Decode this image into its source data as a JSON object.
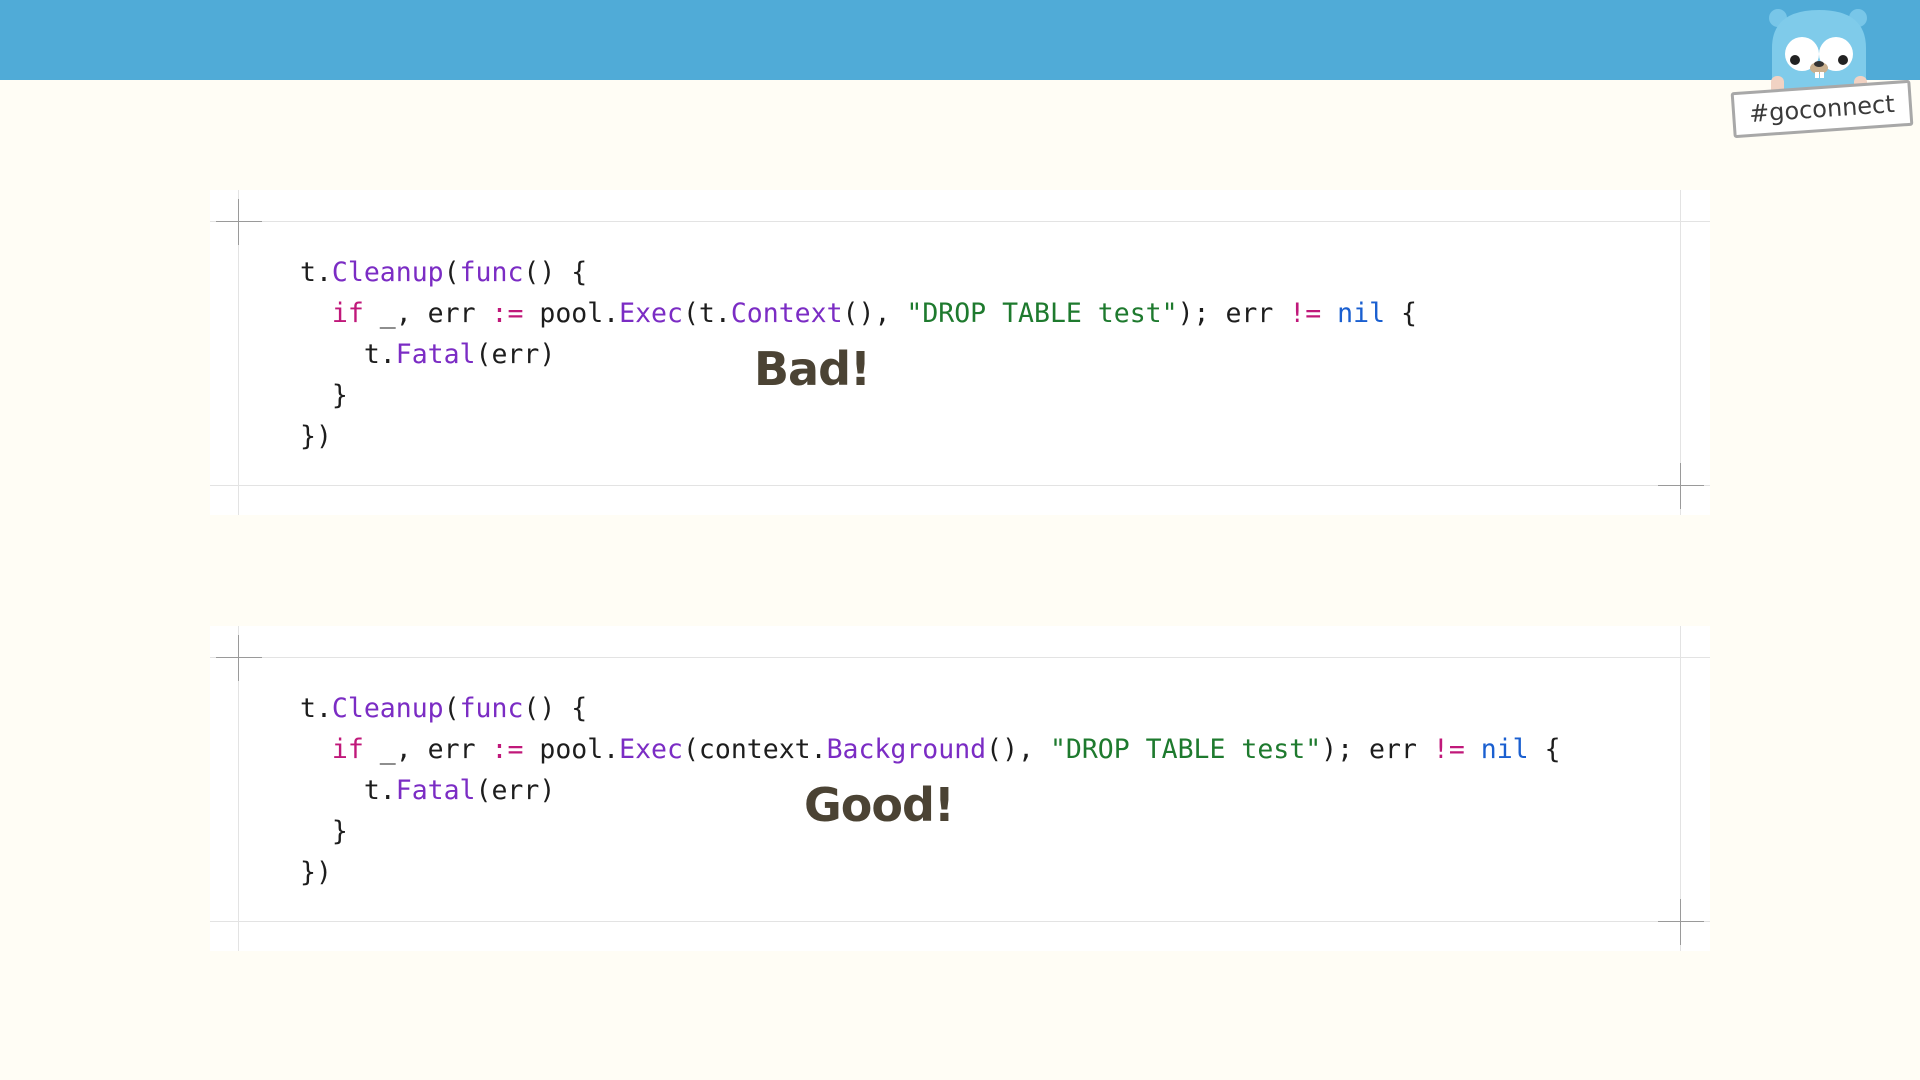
{
  "header": {
    "hashtag": "#goconnect"
  },
  "colors": {
    "header_bar": "#50abd7",
    "background": "#fffdf5",
    "function": "#7b2cc4",
    "keyword": "#c0187a",
    "string": "#1e7a2e",
    "nil": "#1a5fd0",
    "verdict": "#4b4334"
  },
  "examples": [
    {
      "verdict": "Bad!",
      "lines": [
        [
          {
            "t": "t.",
            "c": ""
          },
          {
            "t": "Cleanup",
            "c": "fn"
          },
          {
            "t": "(",
            "c": ""
          },
          {
            "t": "func",
            "c": "fn"
          },
          {
            "t": "() {",
            "c": ""
          }
        ],
        [
          {
            "t": "  ",
            "c": ""
          },
          {
            "t": "if",
            "c": "kw"
          },
          {
            "t": " _, err ",
            "c": ""
          },
          {
            "t": ":=",
            "c": "op"
          },
          {
            "t": " pool.",
            "c": ""
          },
          {
            "t": "Exec",
            "c": "fn"
          },
          {
            "t": "(t.",
            "c": ""
          },
          {
            "t": "Context",
            "c": "fn"
          },
          {
            "t": "(), ",
            "c": ""
          },
          {
            "t": "\"DROP TABLE test\"",
            "c": "str"
          },
          {
            "t": "); err ",
            "c": ""
          },
          {
            "t": "!=",
            "c": "op"
          },
          {
            "t": " ",
            "c": ""
          },
          {
            "t": "nil",
            "c": "nil"
          },
          {
            "t": " {",
            "c": ""
          }
        ],
        [
          {
            "t": "    t.",
            "c": ""
          },
          {
            "t": "Fatal",
            "c": "fn"
          },
          {
            "t": "(err)",
            "c": ""
          }
        ],
        [
          {
            "t": "  }",
            "c": ""
          }
        ],
        [
          {
            "t": "})",
            "c": ""
          }
        ]
      ]
    },
    {
      "verdict": "Good!",
      "lines": [
        [
          {
            "t": "t.",
            "c": ""
          },
          {
            "t": "Cleanup",
            "c": "fn"
          },
          {
            "t": "(",
            "c": ""
          },
          {
            "t": "func",
            "c": "fn"
          },
          {
            "t": "() {",
            "c": ""
          }
        ],
        [
          {
            "t": "  ",
            "c": ""
          },
          {
            "t": "if",
            "c": "kw"
          },
          {
            "t": " _, err ",
            "c": ""
          },
          {
            "t": ":=",
            "c": "op"
          },
          {
            "t": " pool.",
            "c": ""
          },
          {
            "t": "Exec",
            "c": "fn"
          },
          {
            "t": "(context.",
            "c": ""
          },
          {
            "t": "Background",
            "c": "fn"
          },
          {
            "t": "(), ",
            "c": ""
          },
          {
            "t": "\"DROP TABLE test\"",
            "c": "str"
          },
          {
            "t": "); err ",
            "c": ""
          },
          {
            "t": "!=",
            "c": "op"
          },
          {
            "t": " ",
            "c": ""
          },
          {
            "t": "nil",
            "c": "nil"
          },
          {
            "t": " {",
            "c": ""
          }
        ],
        [
          {
            "t": "    t.",
            "c": ""
          },
          {
            "t": "Fatal",
            "c": "fn"
          },
          {
            "t": "(err)",
            "c": ""
          }
        ],
        [
          {
            "t": "  }",
            "c": ""
          }
        ],
        [
          {
            "t": "})",
            "c": ""
          }
        ]
      ]
    }
  ]
}
